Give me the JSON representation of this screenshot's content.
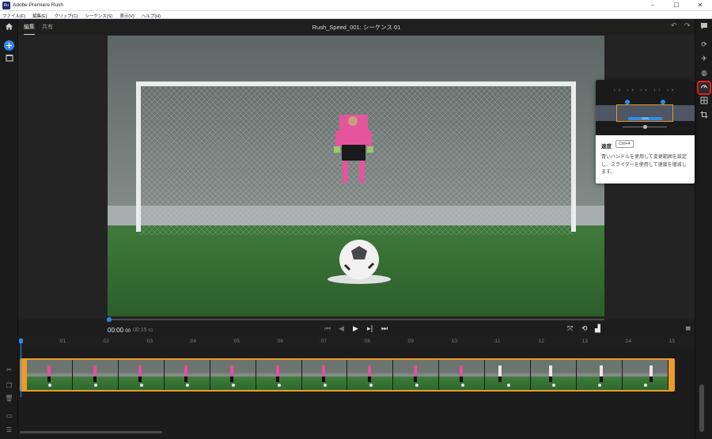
{
  "window": {
    "title": "Adobe Premiere Rush",
    "logo": "Ru",
    "minimize": "–",
    "maximize": "☐",
    "close": "✕"
  },
  "menu": [
    "ファイル(F)",
    "編集(E)",
    "クリップ(C)",
    "シーケンス(S)",
    "表示(V)",
    "ヘルプ(H)"
  ],
  "topbar": {
    "tabs": [
      "編集",
      "共有"
    ],
    "sequence_title": "Rush_Speed_001: シーケンス 01"
  },
  "player": {
    "current_time": "00:00",
    "current_frames": "00",
    "total_time": "00:15",
    "total_frames": "01"
  },
  "ruler": {
    "ticks": [
      ":01",
      ":02",
      ":03",
      ":04",
      ":05",
      ":06",
      ":07",
      ":08",
      ":09",
      ":10",
      ":11",
      ":12",
      ":13",
      ":14",
      ":15"
    ]
  },
  "timeline": {
    "thumbnail_count": 14
  },
  "tooltip": {
    "ruler_ticks": "14 15 16 17 18",
    "bar_label": "100%",
    "title": "速度",
    "shortcut": "Ctrl+4",
    "description": "青いハンドルを使用して変更範囲を設定し、スライダーを使用して速度を増減します。"
  },
  "icons": {
    "home": "home-icon",
    "add": "add-icon",
    "media": "media-icon",
    "comment": "comment-icon",
    "undo": "undo-icon",
    "redo": "redo-icon",
    "speed": "speed-icon",
    "color": "color-icon",
    "audio": "audio-icon",
    "transform": "transform-icon",
    "crop": "crop-icon",
    "titles": "titles-icon"
  },
  "colors": {
    "accent_blue": "#2d8ceb",
    "clip_orange": "#eb9b2a",
    "highlight_red": "#e81c24"
  }
}
